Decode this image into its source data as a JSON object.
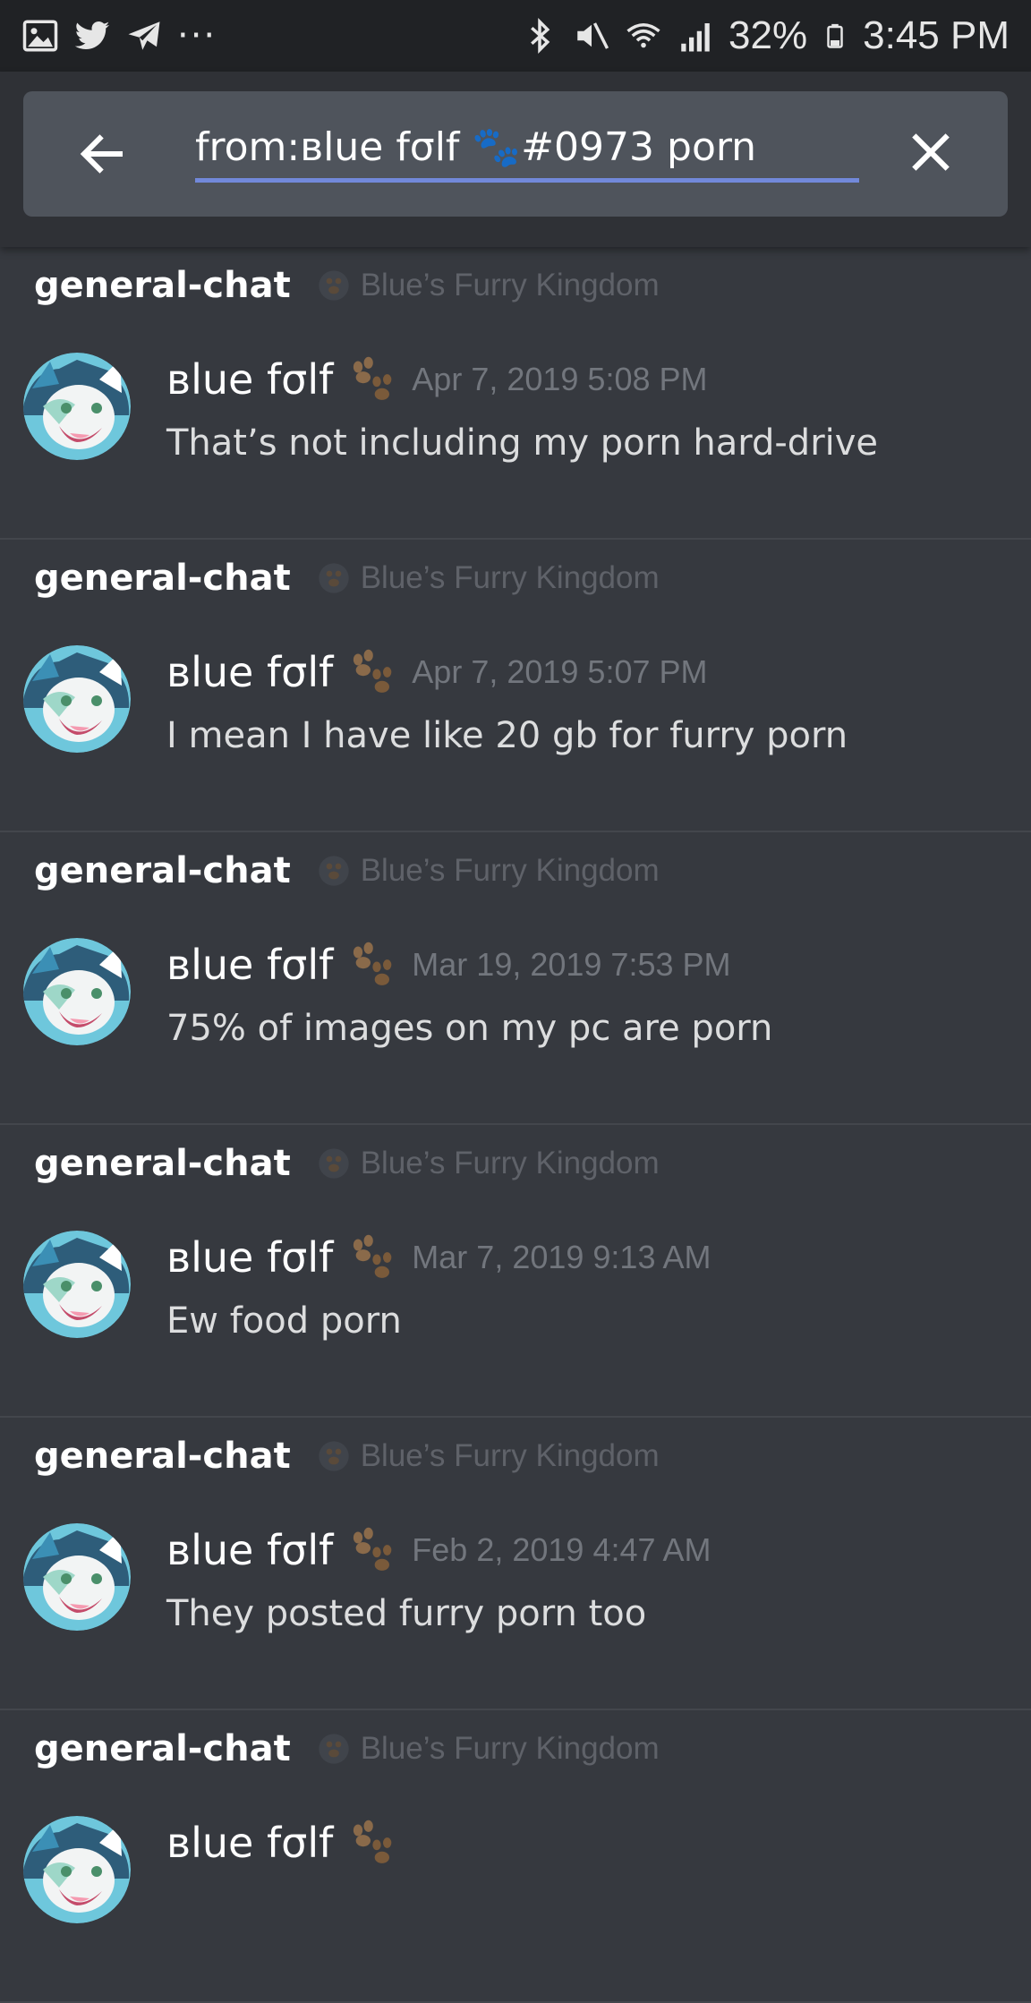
{
  "status_bar": {
    "left_icons": [
      "gallery-icon",
      "twitter-icon",
      "telegram-icon"
    ],
    "more": "···",
    "right_icons": [
      "bluetooth-icon",
      "mute-icon",
      "wifi-icon",
      "signal-icon"
    ],
    "battery": "32%",
    "time": "3:45 PM"
  },
  "search": {
    "query": "from:вlue fσlf 🐾#0973 porn",
    "back_icon": "arrow-left-icon",
    "clear_icon": "close-icon",
    "accent": "#7289da"
  },
  "results": [
    {
      "channel": "general-chat",
      "guild": "Blue’s Furry Kingdom",
      "author": "вlue fσlf",
      "timestamp": "Apr 7, 2019 5:08 PM",
      "message": "That’s not including my porn hard-drive"
    },
    {
      "channel": "general-chat",
      "guild": "Blue’s Furry Kingdom",
      "author": "вlue fσlf",
      "timestamp": "Apr 7, 2019 5:07 PM",
      "message": "I mean I have like 20 gb for furry porn"
    },
    {
      "channel": "general-chat",
      "guild": "Blue’s Furry Kingdom",
      "author": "вlue fσlf",
      "timestamp": "Mar 19, 2019 7:53 PM",
      "message": "75% of images on my pc are porn"
    },
    {
      "channel": "general-chat",
      "guild": "Blue’s Furry Kingdom",
      "author": "вlue fσlf",
      "timestamp": "Mar 7, 2019 9:13 AM",
      "message": "Ew food porn"
    },
    {
      "channel": "general-chat",
      "guild": "Blue’s Furry Kingdom",
      "author": "вlue fσlf",
      "timestamp": "Feb 2, 2019 4:47 AM",
      "message": "They posted furry porn too"
    },
    {
      "channel": "general-chat",
      "guild": "Blue’s Furry Kingdom",
      "author": "вlue fσlf",
      "timestamp": "",
      "message": ""
    }
  ]
}
